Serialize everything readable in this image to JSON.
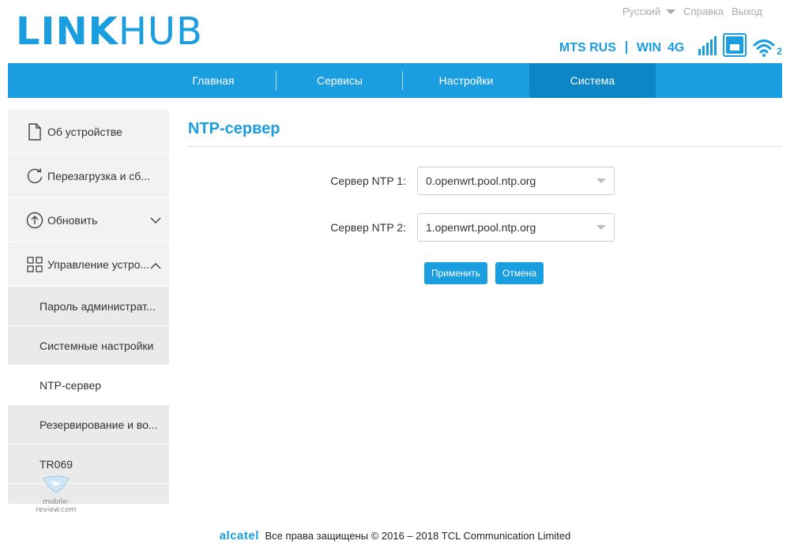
{
  "header": {
    "logo_bold": "LINK",
    "logo_thin": "HUB",
    "language": "Русский",
    "help": "Справка",
    "logout": "Выход",
    "operator": "MTS RUS",
    "network": "WIN",
    "network_type": "4G",
    "wifi_clients": "2"
  },
  "nav": {
    "items": [
      "Главная",
      "Сервисы",
      "Настройки",
      "Система"
    ],
    "active": "Система"
  },
  "sidebar": {
    "items": [
      {
        "label": "Об устройстве",
        "icon": "document-icon"
      },
      {
        "label": "Перезагрузка и сб...",
        "icon": "refresh-icon"
      },
      {
        "label": "Обновить",
        "icon": "upload-circle-icon"
      },
      {
        "label": "Управление устро...",
        "icon": "grid-icon"
      }
    ],
    "subitems": [
      "Пароль администрат...",
      "Системные настройки",
      "NTP-сервер",
      "Резервирование и во...",
      "TR069"
    ]
  },
  "content": {
    "title": "NTP-сервер",
    "ntp1_label": "Сервер NTP 1:",
    "ntp1_value": "0.openwrt.pool.ntp.org",
    "ntp2_label": "Сервер NTP 2:",
    "ntp2_value": "1.openwrt.pool.ntp.org",
    "apply": "Применить",
    "cancel": "Отмена"
  },
  "watermark": "mobile-review.com",
  "footer": {
    "brand": "alcatel",
    "text": "Все права защищены © 2016 – 2018 TCL Communication Limited"
  },
  "colors": {
    "accent": "#1a9ee0",
    "nav_active": "#0c86c4",
    "sidebar_bg": "#f2f2f2"
  }
}
